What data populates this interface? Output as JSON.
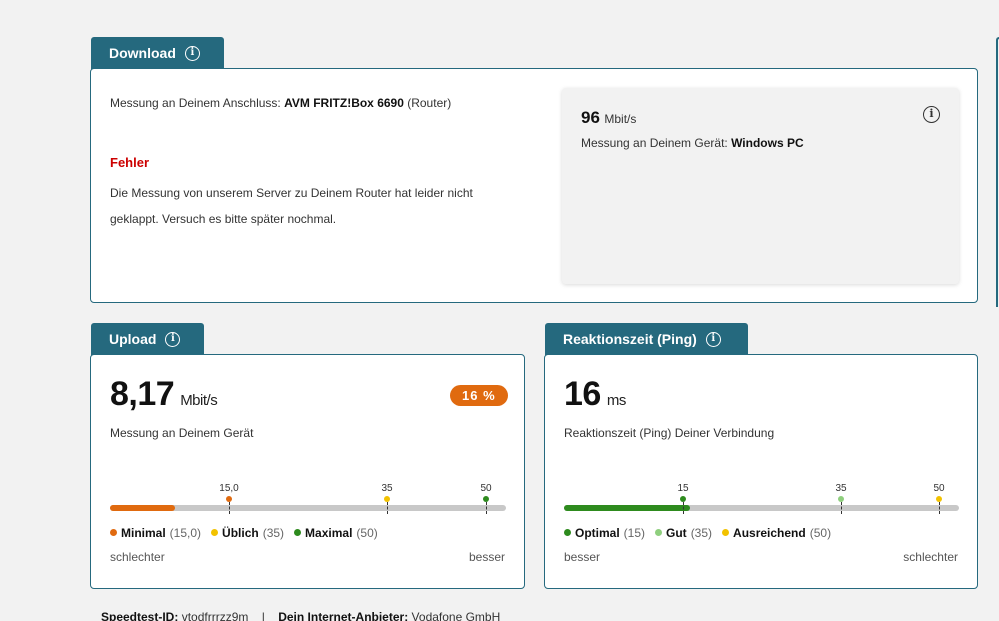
{
  "download": {
    "tab_label": "Download",
    "anschluss_prefix": "Messung an Deinem Anschluss: ",
    "anschluss_device": "AVM FRITZ!Box 6690",
    "anschluss_suffix": " (Router)",
    "error_title": "Fehler",
    "error_line1": "Die Messung von unserem Server zu Deinem Router hat leider nicht",
    "error_line2": "geklappt. Versuch es bitte später nochmal.",
    "device_value": "96",
    "device_unit": "Mbit/s",
    "device_prefix": "Messung an Deinem Gerät: ",
    "device_name": "Windows PC"
  },
  "upload": {
    "tab_label": "Upload",
    "value": "8,17",
    "unit": "Mbit/s",
    "subtitle": "Messung an Deinem Gerät",
    "badge": "16 %",
    "scale_max": 50,
    "current_value": 8.17,
    "ticks": [
      {
        "label": "15,0",
        "value": 15,
        "color": "#e06a0f"
      },
      {
        "label": "35",
        "value": 35,
        "color": "#f2c200"
      },
      {
        "label": "50",
        "value": 50,
        "color": "#2e8b1e"
      }
    ],
    "fill_color": "#e06a0f",
    "legend": [
      {
        "name": "Minimal",
        "val": "(15,0)",
        "color": "#e06a0f"
      },
      {
        "name": "Üblich",
        "val": "(35)",
        "color": "#f2c200"
      },
      {
        "name": "Maximal",
        "val": "(50)",
        "color": "#2e8b1e"
      }
    ],
    "left_label": "schlechter",
    "right_label": "besser"
  },
  "ping": {
    "tab_label": "Reaktionszeit (Ping)",
    "value": "16",
    "unit": "ms",
    "subtitle": "Reaktionszeit (Ping) Deiner Verbindung",
    "scale_max": 50,
    "current_value": 16,
    "ticks": [
      {
        "label": "15",
        "value": 15,
        "color": "#2e8b1e"
      },
      {
        "label": "35",
        "value": 35,
        "color": "#8fcf7e"
      },
      {
        "label": "50",
        "value": 50,
        "color": "#f2c200"
      }
    ],
    "fill_color": "#2e8b1e",
    "legend": [
      {
        "name": "Optimal",
        "val": "(15)",
        "color": "#2e8b1e"
      },
      {
        "name": "Gut",
        "val": "(35)",
        "color": "#8fcf7e"
      },
      {
        "name": "Ausreichend",
        "val": "(50)",
        "color": "#f2c200"
      }
    ],
    "left_label": "besser",
    "right_label": "schlechter"
  },
  "footer": {
    "speedtest_label": "Speedtest-ID:",
    "speedtest_value": "vtodfrrrzz9m",
    "separator": "|",
    "provider_label": "Dein Internet-Anbieter:",
    "provider_value": "Vodafone GmbH"
  },
  "icons": {
    "info": "info-icon"
  }
}
